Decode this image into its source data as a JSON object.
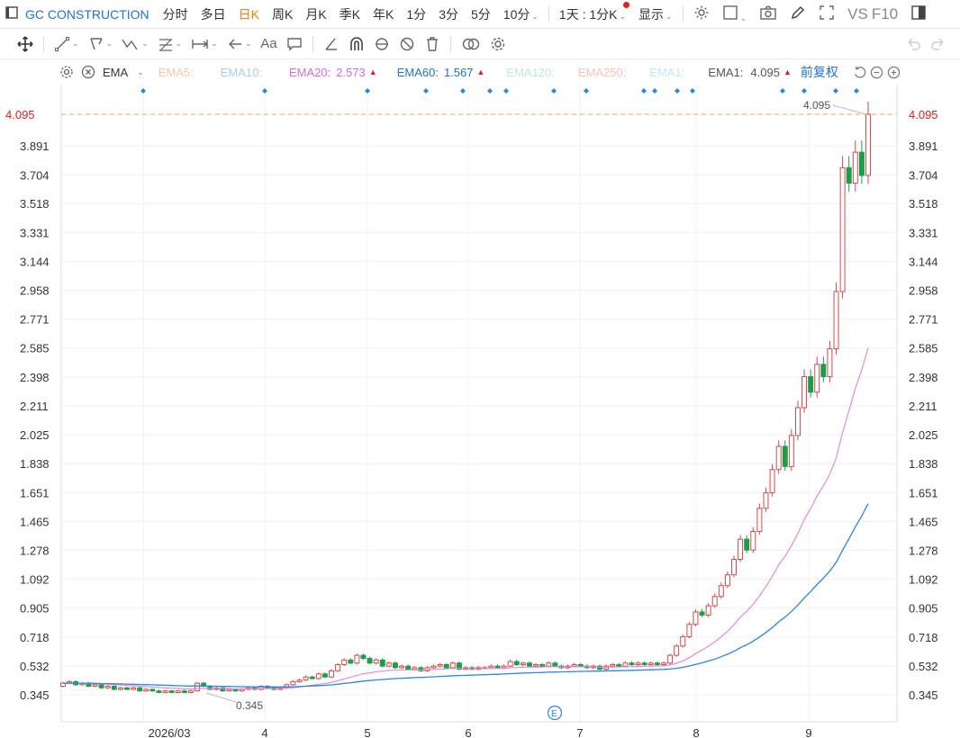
{
  "topbar": {
    "title": "GC CONSTRUCTION",
    "periods": [
      "分时",
      "多日",
      "日K",
      "周K",
      "月K",
      "季K",
      "年K",
      "1分",
      "3分",
      "5分",
      "10分"
    ],
    "active_period": "日K",
    "interval": "1天 : 1分K",
    "display": "显示",
    "vs": "VS",
    "f10": "F10"
  },
  "legend": {
    "indicator": "EMA",
    "ema5": "EMA5:",
    "ema10": "EMA10:",
    "ema20_label": "EMA20:",
    "ema20_value": "2.573",
    "ema60_label": "EMA60:",
    "ema60_value": "1.567",
    "ema120": "EMA120:",
    "ema250": "EMA250:",
    "emaA": "EMA1:",
    "ema1_label": "EMA1:",
    "ema1_value": "4.095",
    "adjust": "前复权"
  },
  "colors": {
    "up": "#d14b4b",
    "down": "#1f9c4a",
    "ema20": "#e48ad9",
    "ema60": "#2d86dd",
    "price_line": "#f0a060",
    "price_tag": "#e02020",
    "ema5": "#f6c7a8",
    "ema10": "#a8cdea",
    "ema120": "#bfe8de",
    "ema250": "#f6c0c0",
    "emaA": "#c3e6f6",
    "marker": "#2d86dd"
  },
  "chart_data": {
    "type": "candlestick",
    "y_ticks": [
      "4.095",
      "3.891",
      "3.704",
      "3.518",
      "3.331",
      "3.144",
      "2.958",
      "2.771",
      "2.585",
      "2.398",
      "2.211",
      "2.025",
      "1.838",
      "1.651",
      "1.465",
      "1.278",
      "1.092",
      "0.905",
      "0.718",
      "0.532",
      "0.345"
    ],
    "x_ticks": [
      "2026/03",
      "4",
      "5",
      "6",
      "7",
      "8",
      "9"
    ],
    "current_price": "4.095",
    "high_label": "4.095",
    "low_label": "0.345",
    "ylim": [
      0.345,
      4.095
    ],
    "ema20_last": 2.573,
    "ema60_last": 1.567,
    "candles": [
      [
        0.4,
        0.42
      ],
      [
        0.42,
        0.43
      ],
      [
        0.43,
        0.41
      ],
      [
        0.41,
        0.42
      ],
      [
        0.42,
        0.4
      ],
      [
        0.4,
        0.41
      ],
      [
        0.41,
        0.39
      ],
      [
        0.39,
        0.4
      ],
      [
        0.4,
        0.38
      ],
      [
        0.38,
        0.39
      ],
      [
        0.39,
        0.38
      ],
      [
        0.38,
        0.39
      ],
      [
        0.39,
        0.37
      ],
      [
        0.37,
        0.38
      ],
      [
        0.38,
        0.37
      ],
      [
        0.37,
        0.36
      ],
      [
        0.36,
        0.37
      ],
      [
        0.37,
        0.36
      ],
      [
        0.36,
        0.37
      ],
      [
        0.37,
        0.36
      ],
      [
        0.36,
        0.37
      ],
      [
        0.37,
        0.42
      ],
      [
        0.42,
        0.4
      ],
      [
        0.4,
        0.38
      ],
      [
        0.38,
        0.39
      ],
      [
        0.39,
        0.37
      ],
      [
        0.37,
        0.38
      ],
      [
        0.38,
        0.37
      ],
      [
        0.37,
        0.38
      ],
      [
        0.38,
        0.39
      ],
      [
        0.39,
        0.38
      ],
      [
        0.38,
        0.4
      ],
      [
        0.4,
        0.39
      ],
      [
        0.39,
        0.38
      ],
      [
        0.38,
        0.39
      ],
      [
        0.39,
        0.41
      ],
      [
        0.41,
        0.43
      ],
      [
        0.43,
        0.44
      ],
      [
        0.44,
        0.46
      ],
      [
        0.46,
        0.45
      ],
      [
        0.45,
        0.48
      ],
      [
        0.48,
        0.46
      ],
      [
        0.46,
        0.5
      ],
      [
        0.5,
        0.54
      ],
      [
        0.54,
        0.57
      ],
      [
        0.57,
        0.55
      ],
      [
        0.55,
        0.6
      ],
      [
        0.6,
        0.58
      ],
      [
        0.58,
        0.55
      ],
      [
        0.55,
        0.57
      ],
      [
        0.57,
        0.53
      ],
      [
        0.53,
        0.55
      ],
      [
        0.55,
        0.52
      ],
      [
        0.52,
        0.53
      ],
      [
        0.53,
        0.51
      ],
      [
        0.51,
        0.52
      ],
      [
        0.52,
        0.5
      ],
      [
        0.5,
        0.52
      ],
      [
        0.52,
        0.53
      ],
      [
        0.53,
        0.54
      ],
      [
        0.54,
        0.52
      ],
      [
        0.52,
        0.55
      ],
      [
        0.55,
        0.51
      ],
      [
        0.51,
        0.52
      ],
      [
        0.52,
        0.51
      ],
      [
        0.51,
        0.52
      ],
      [
        0.52,
        0.52
      ],
      [
        0.52,
        0.53
      ],
      [
        0.53,
        0.52
      ],
      [
        0.52,
        0.53
      ],
      [
        0.53,
        0.56
      ],
      [
        0.56,
        0.54
      ],
      [
        0.54,
        0.55
      ],
      [
        0.55,
        0.53
      ],
      [
        0.53,
        0.54
      ],
      [
        0.54,
        0.53
      ],
      [
        0.53,
        0.55
      ],
      [
        0.55,
        0.53
      ],
      [
        0.53,
        0.52
      ],
      [
        0.52,
        0.53
      ],
      [
        0.53,
        0.54
      ],
      [
        0.54,
        0.53
      ],
      [
        0.53,
        0.52
      ],
      [
        0.52,
        0.53
      ],
      [
        0.53,
        0.51
      ],
      [
        0.51,
        0.53
      ],
      [
        0.53,
        0.54
      ],
      [
        0.54,
        0.53
      ],
      [
        0.53,
        0.55
      ],
      [
        0.55,
        0.54
      ],
      [
        0.54,
        0.55
      ],
      [
        0.55,
        0.54
      ],
      [
        0.54,
        0.55
      ],
      [
        0.55,
        0.54
      ],
      [
        0.54,
        0.55
      ],
      [
        0.55,
        0.6
      ],
      [
        0.6,
        0.66
      ],
      [
        0.66,
        0.72
      ],
      [
        0.72,
        0.8
      ],
      [
        0.8,
        0.88
      ],
      [
        0.88,
        0.86
      ],
      [
        0.86,
        0.92
      ],
      [
        0.92,
        0.98
      ],
      [
        0.98,
        1.05
      ],
      [
        1.05,
        1.12
      ],
      [
        1.12,
        1.22
      ],
      [
        1.22,
        1.35
      ],
      [
        1.35,
        1.28
      ],
      [
        1.28,
        1.4
      ],
      [
        1.4,
        1.55
      ],
      [
        1.55,
        1.65
      ],
      [
        1.65,
        1.8
      ],
      [
        1.8,
        1.95
      ],
      [
        1.95,
        1.82
      ],
      [
        1.82,
        2.02
      ],
      [
        2.02,
        2.2
      ],
      [
        2.2,
        2.4
      ],
      [
        2.4,
        2.3
      ],
      [
        2.3,
        2.48
      ],
      [
        2.48,
        2.4
      ],
      [
        2.4,
        2.58
      ],
      [
        2.58,
        2.95
      ],
      [
        2.95,
        3.75
      ],
      [
        3.75,
        3.65
      ],
      [
        3.65,
        3.85
      ],
      [
        3.85,
        3.7
      ],
      [
        3.7,
        4.095
      ]
    ],
    "markers_x": [
      159,
      294,
      408,
      473,
      514,
      544,
      562,
      615,
      651,
      715,
      727,
      752,
      769,
      869,
      893,
      928,
      951
    ]
  }
}
